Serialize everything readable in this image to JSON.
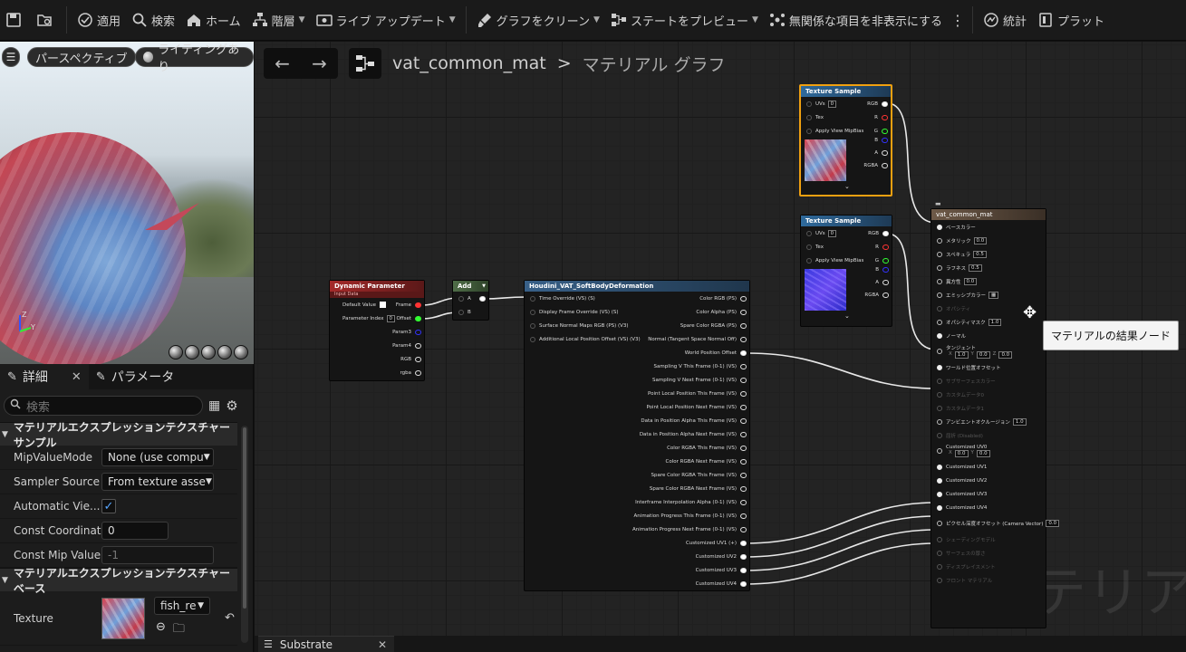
{
  "toolbar": {
    "items": [
      {
        "label": "適用",
        "icon": "apply-icon"
      },
      {
        "label": "検索",
        "icon": "search-icon"
      },
      {
        "label": "ホーム",
        "icon": "home-icon"
      },
      {
        "label": "階層",
        "icon": "hierarchy-icon"
      },
      {
        "label": "ライブ アップデート",
        "icon": "live-update-icon"
      },
      {
        "label": "グラフをクリーン",
        "icon": "clean-graph-icon"
      },
      {
        "label": "ステートをプレビュー",
        "icon": "preview-state-icon"
      },
      {
        "label": "無関係な項目を非表示にする",
        "icon": "hide-unrelated-icon"
      },
      {
        "label": "統計",
        "icon": "stats-icon"
      },
      {
        "label": "プラット",
        "icon": "platform-icon"
      }
    ]
  },
  "viewport": {
    "perspective": "パースペクティブ",
    "lighting": "ライティングあり"
  },
  "details": {
    "tab_details": "詳細",
    "tab_params": "パラメータ",
    "search_placeholder": "検索",
    "section1": "マテリアルエクスプレッションテクスチャーサンプル",
    "rows": [
      {
        "label": "MipValueMode",
        "value": "None (use compu"
      },
      {
        "label": "Sampler Source",
        "value": "From texture asse"
      },
      {
        "label": "Automatic Vie...",
        "value": "✓"
      },
      {
        "label": "Const Coordinate",
        "value": "0"
      },
      {
        "label": "Const Mip Value",
        "value": "-1"
      }
    ],
    "section2": "マテリアルエクスプレッションテクスチャーベース",
    "texture_label": "Texture",
    "texture_value": "fish_re"
  },
  "graph": {
    "breadcrumb_asset": "vat_common_mat",
    "breadcrumb_sep": ">",
    "breadcrumb_graph": "マテリアル グラフ",
    "watermark": "マテリア",
    "tooltip": "マテリアルの結果ノード",
    "ts1": {
      "title": "Texture Sample",
      "uvs": "UVs",
      "uv_val": "0",
      "tex": "Tex",
      "mip": "Apply View MipBias",
      "outs": [
        "RGB",
        "R",
        "G",
        "B",
        "A",
        "RGBA"
      ]
    },
    "ts2": {
      "title": "Texture Sample",
      "uvs": "UVs",
      "uv_val": "0",
      "tex": "Tex",
      "mip": "Apply View MipBias",
      "outs": [
        "RGB",
        "R",
        "G",
        "B",
        "A",
        "RGBA"
      ]
    },
    "dyn": {
      "title": "Dynamic Parameter",
      "sub": "Input Data",
      "default_value": "Default Value",
      "param_index": "Parameter Index",
      "param_index_val": "0",
      "outs": [
        "Frame",
        "Offset",
        "Param3",
        "Param4",
        "RGB",
        "rgba"
      ]
    },
    "add": {
      "title": "Add",
      "a": "A",
      "b": "B"
    },
    "houdini": {
      "title": "Houdini_VAT_SoftBodyDeformation",
      "inputs": [
        "Time Override (VS) (S)",
        "Display Frame Override (VS) (S)",
        "Surface Normal Maps RGB (PS) (V3)",
        "Additional Local Position Offset (VS) (V3)"
      ],
      "outputs": [
        "Color RGB (PS)",
        "Color Alpha (PS)",
        "Spare Color RGBA (PS)",
        "Normal (Tangent Space Normal Off)",
        "World Position Offset",
        "Sampling V This Frame (0-1) (VS)",
        "Sampling V Next Frame (0-1) (VS)",
        "Point Local Position This Frame (VS)",
        "Point Local Position Next Frame (VS)",
        "Data in Position Alpha This Frame (VS)",
        "Data in Position Alpha Next Frame (VS)",
        "Color RGBA This Frame (VS)",
        "Color RGBA Next Frame (VS)",
        "Spare Color RGBA This Frame (VS)",
        "Spare Color RGBA Next Frame (VS)",
        "Interframe Interpolation Alpha (0-1) (VS)",
        "Animation Progress This Frame (0-1) (VS)",
        "Animation Progress Next Frame (0-1) (VS)",
        "Customized UV1 (+)",
        "Customized UV2",
        "Customized UV3",
        "Customized UV4"
      ]
    },
    "result": {
      "title": "vat_common_mat",
      "pins": [
        {
          "label": "ベースカラー"
        },
        {
          "label": "メタリック",
          "val": "0.0"
        },
        {
          "label": "スペキュラ",
          "val": "0.5"
        },
        {
          "label": "ラフネス",
          "val": "0.5"
        },
        {
          "label": "異方性",
          "val": "0.0"
        },
        {
          "label": "エミッシブカラー",
          "val": "▦"
        },
        {
          "label": "オパシティ",
          "dim": true
        },
        {
          "label": "オパシティマスク",
          "val": "1.0"
        },
        {
          "label": "ノーマル"
        },
        {
          "label": "タンジェント",
          "xyz": [
            "1.0",
            "0.0",
            "0.0"
          ]
        },
        {
          "label": "ワールド位置オフセット"
        },
        {
          "label": "サブサーフェスカラー",
          "dim": true
        },
        {
          "label": "カスタムデータ0",
          "dim": true
        },
        {
          "label": "カスタムデータ1",
          "dim": true
        },
        {
          "label": "アンビエントオクルージョン",
          "val": "1.0"
        },
        {
          "label": "屈折 (Disabled)",
          "dim": true
        },
        {
          "label": "Customized UV0",
          "xy": [
            "0.0",
            "0.0"
          ]
        },
        {
          "label": "Customized UV1"
        },
        {
          "label": "Customized UV2"
        },
        {
          "label": "Customized UV3"
        },
        {
          "label": "Customized UV4"
        },
        {
          "label": "ピクセル深度オフセット (Camera Vector)",
          "val": "0.0"
        },
        {
          "label": "シェーディングモデル",
          "dim": true
        },
        {
          "label": "サーフェスの厚さ",
          "dim": true
        },
        {
          "label": "ディスプレイスメント",
          "dim": true
        },
        {
          "label": "フロント マテリアル",
          "dim": true
        }
      ]
    }
  },
  "bottom_tab": "Substrate",
  "colors": {
    "accent": "#2f6fd0",
    "selected_node": "#f0a010",
    "ts_header": "#2f6a9c",
    "dyn_header": "#a52a2a",
    "add_header": "#4f6e48",
    "houdini_header": "#386088",
    "result_header": "#6e5a48"
  }
}
